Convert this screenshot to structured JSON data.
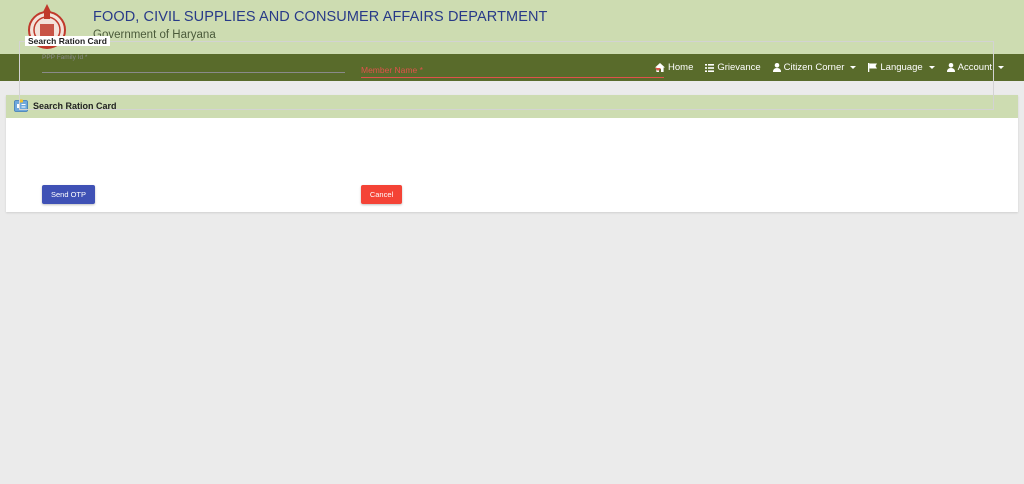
{
  "header": {
    "title": "FOOD, CIVIL SUPPLIES AND CONSUMER AFFAIRS DEPARTMENT",
    "subtitle": "Government of Haryana",
    "title_color": "#283a88",
    "background": "#cddcb1",
    "emblem_icon": "haryana-emblem-icon"
  },
  "navbar": {
    "background": "#596b2b",
    "items": [
      {
        "label": "Home",
        "icon": "home-icon",
        "dropdown": false
      },
      {
        "label": "Grievance",
        "icon": "list-icon",
        "dropdown": false
      },
      {
        "label": "Citizen Corner",
        "icon": "user-icon",
        "dropdown": true
      },
      {
        "label": "Language",
        "icon": "flag-icon",
        "dropdown": true
      },
      {
        "label": "Account",
        "icon": "user-icon",
        "dropdown": true
      }
    ]
  },
  "card": {
    "title": "Search Ration Card",
    "icon": "id-card-icon",
    "fieldset_legend": "Search Ration Card",
    "ppp_field": {
      "label": "PPP Family Id *",
      "value": ""
    },
    "member_select": {
      "label": "Member Name *",
      "color": "#e0524b"
    },
    "send_otp_label": "Send OTP",
    "cancel_label": "Cancel",
    "send_otp_color": "#3f51b5",
    "cancel_color": "#f44336"
  }
}
